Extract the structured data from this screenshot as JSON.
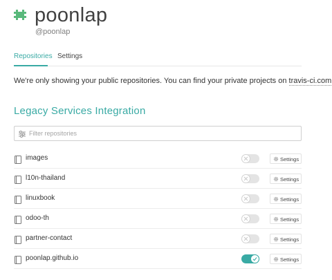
{
  "profile": {
    "username": "poonlap",
    "handle": "@poonlap",
    "avatar_icon": "pixel-avatar-icon",
    "avatar_color": "#59b97b"
  },
  "tabs": [
    {
      "label": "Repositories",
      "active": true
    },
    {
      "label": "Settings",
      "active": false
    }
  ],
  "notice": {
    "text": "We're only showing your public repositories. You can find your private projects on ",
    "link": "travis-ci.com",
    "suffix": " ."
  },
  "section_title": "Legacy Services Integration",
  "filter": {
    "placeholder": "Filter repositories",
    "value": "",
    "icon": "sliders-icon"
  },
  "repositories": [
    {
      "name": "images",
      "enabled": false,
      "settings_label": "Settings"
    },
    {
      "name": "l10n-thailand",
      "enabled": false,
      "settings_label": "Settings"
    },
    {
      "name": "linuxbook",
      "enabled": false,
      "settings_label": "Settings"
    },
    {
      "name": "odoo-th",
      "enabled": false,
      "settings_label": "Settings"
    },
    {
      "name": "partner-contact",
      "enabled": false,
      "settings_label": "Settings"
    },
    {
      "name": "poonlap.github.io",
      "enabled": true,
      "settings_label": "Settings"
    }
  ],
  "colors": {
    "accent": "#39aaa4",
    "toggle_off": "#e4e4e4"
  }
}
